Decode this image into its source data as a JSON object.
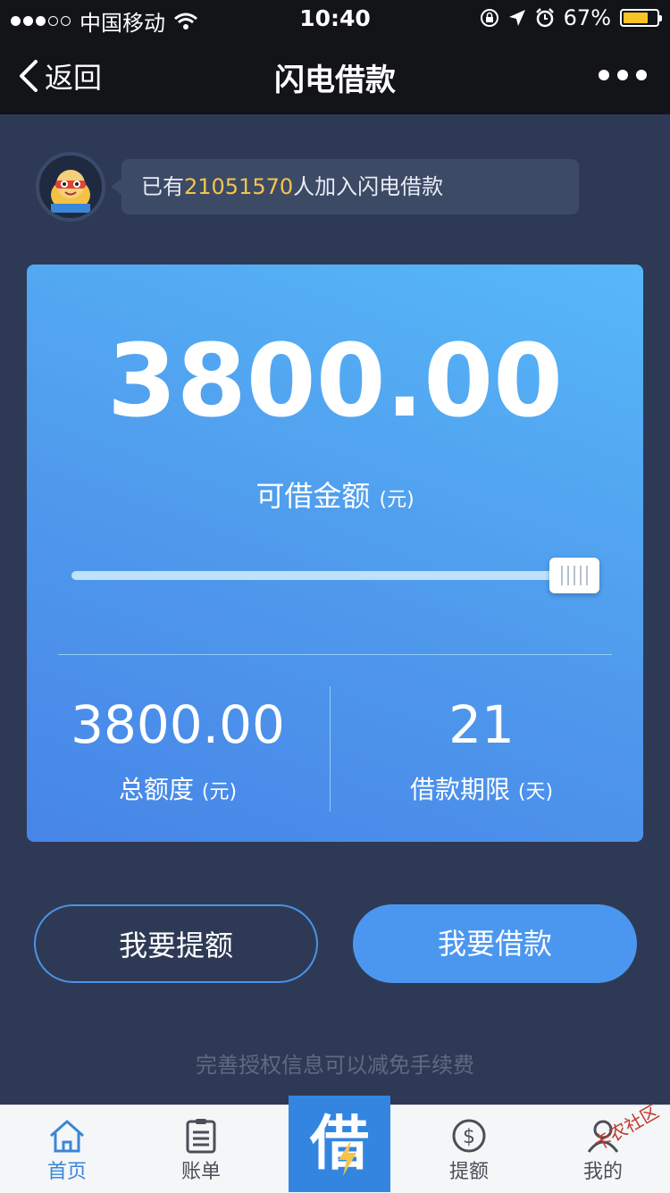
{
  "status": {
    "carrier": "中国移动",
    "time": "10:40",
    "battery": "67%"
  },
  "nav": {
    "back_label": "返回",
    "title": "闪电借款"
  },
  "notice": {
    "prefix": "已有",
    "count": "21051570",
    "suffix": "人加入闪电借款"
  },
  "card": {
    "amount": "3800.00",
    "amount_label": "可借金额",
    "amount_unit": "(元)",
    "slider_level": 1.0,
    "total_value": "3800.00",
    "total_label": "总额度",
    "total_unit": "(元)",
    "term_value": "21",
    "term_label": "借款期限",
    "term_unit": "(天)"
  },
  "actions": {
    "raise_label": "我要提额",
    "borrow_label": "我要借款"
  },
  "hint": "完善授权信息可以减免手续费",
  "tabs": {
    "home": "首页",
    "bill": "账单",
    "center": "借",
    "raise": "提额",
    "mine": "我的"
  },
  "watermark": "卡农社区",
  "colors": {
    "accent": "#4b97f0",
    "highlight": "#f4c54a",
    "background": "#2e3a55"
  }
}
